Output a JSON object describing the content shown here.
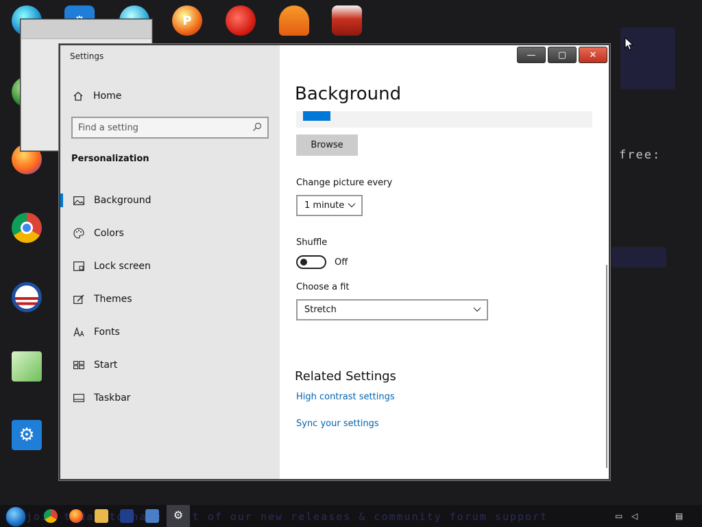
{
  "theme": {
    "accent": "#0078d7",
    "link": "#0063b1",
    "nav_bg": "#e6e6e6",
    "close_red": "#c0321e"
  },
  "desktop": {
    "icons": [
      {
        "icon": "globe-icon"
      },
      {
        "icon": "gear-icon"
      },
      {
        "icon": "browser-icon"
      },
      {
        "icon": "game-p-icon"
      },
      {
        "icon": "angry-bird-icon"
      },
      {
        "icon": "vlc-cone-icon"
      },
      {
        "icon": "book-icon"
      },
      {
        "icon": "globe-green-icon"
      },
      {
        "icon": "firefox-icon"
      },
      {
        "icon": "chrome-icon"
      },
      {
        "icon": "obama-logo-icon"
      },
      {
        "icon": "notepad-icon"
      },
      {
        "icon": "gear-icon"
      }
    ],
    "banner": {
      "right_text": "free:"
    }
  },
  "settings_window": {
    "title": "Settings",
    "caption": {
      "minimize": "—",
      "maximize": "▢",
      "close": "✕"
    },
    "nav": {
      "home_label": "Home",
      "search_placeholder": "Find a setting",
      "section_label": "Personalization",
      "items": [
        {
          "label": "Background",
          "icon": "picture-icon",
          "active": true
        },
        {
          "label": "Colors",
          "icon": "palette-icon",
          "active": false
        },
        {
          "label": "Lock screen",
          "icon": "lock-screen-icon",
          "active": false
        },
        {
          "label": "Themes",
          "icon": "themes-icon",
          "active": false
        },
        {
          "label": "Fonts",
          "icon": "fonts-icon",
          "active": false
        },
        {
          "label": "Start",
          "icon": "start-icon",
          "active": false
        },
        {
          "label": "Taskbar",
          "icon": "taskbar-icon",
          "active": false
        }
      ]
    },
    "content": {
      "title": "Background",
      "browse_label": "Browse",
      "change_picture_label": "Change picture every",
      "change_picture_value": "1 minute",
      "shuffle_label": "Shuffle",
      "shuffle_state": "Off",
      "fit_label": "Choose a fit",
      "fit_value": "Stretch",
      "related_title": "Related Settings",
      "links": [
        {
          "label": "High contrast settings"
        },
        {
          "label": "Sync your settings"
        }
      ]
    }
  },
  "taskbar": {
    "ticker": "join today to have rest of our new releases & community forum support"
  }
}
